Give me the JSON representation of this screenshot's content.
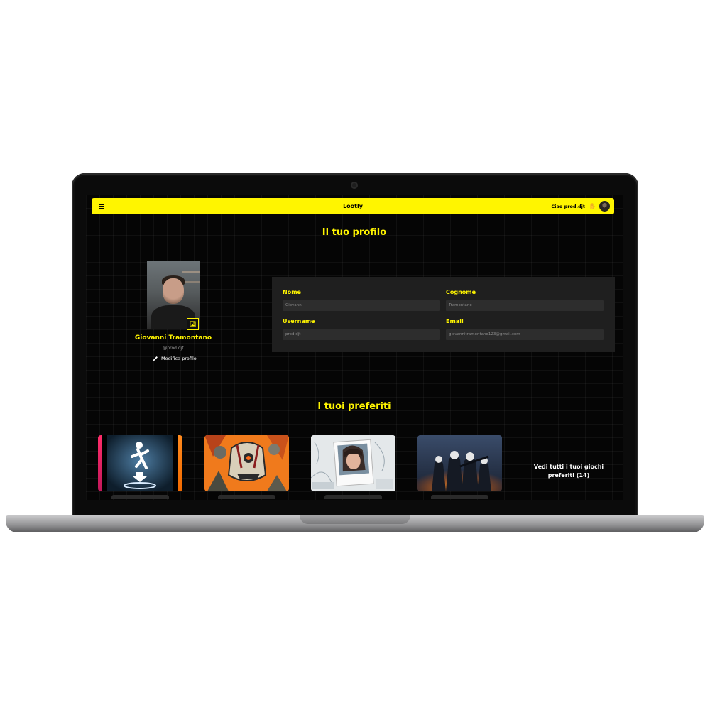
{
  "navbar": {
    "brand": "Lootly",
    "greeting": "Ciao prod.djt",
    "greeting_icon": "waving-hand-icon",
    "accent_color": "#fff500"
  },
  "profile": {
    "section_title": "Il tuo profilo",
    "name": "Giovanni Tramontano",
    "handle": "@prod.djt",
    "edit_label": "Modifica profilo"
  },
  "form": {
    "fields": [
      {
        "label": "Nome",
        "value": "Giovanni"
      },
      {
        "label": "Cognome",
        "value": "Tramontano"
      },
      {
        "label": "Username",
        "value": "prod.djt"
      },
      {
        "label": "Email",
        "value": "giovannitramontano123@gmail.com"
      }
    ]
  },
  "favorites": {
    "section_title": "I tuoi preferiti",
    "games": [
      {
        "id": "portal",
        "icon": "portal-stick-figure-icon"
      },
      {
        "id": "borderlands",
        "icon": "psycho-mask-art"
      },
      {
        "id": "life-is-strange",
        "icon": "polaroid-portrait-art"
      },
      {
        "id": "payday",
        "icon": "masked-crew-art"
      }
    ],
    "see_all_label": "Vedi tutti i tuoi giochi preferiti",
    "see_all_count": "(14)"
  }
}
